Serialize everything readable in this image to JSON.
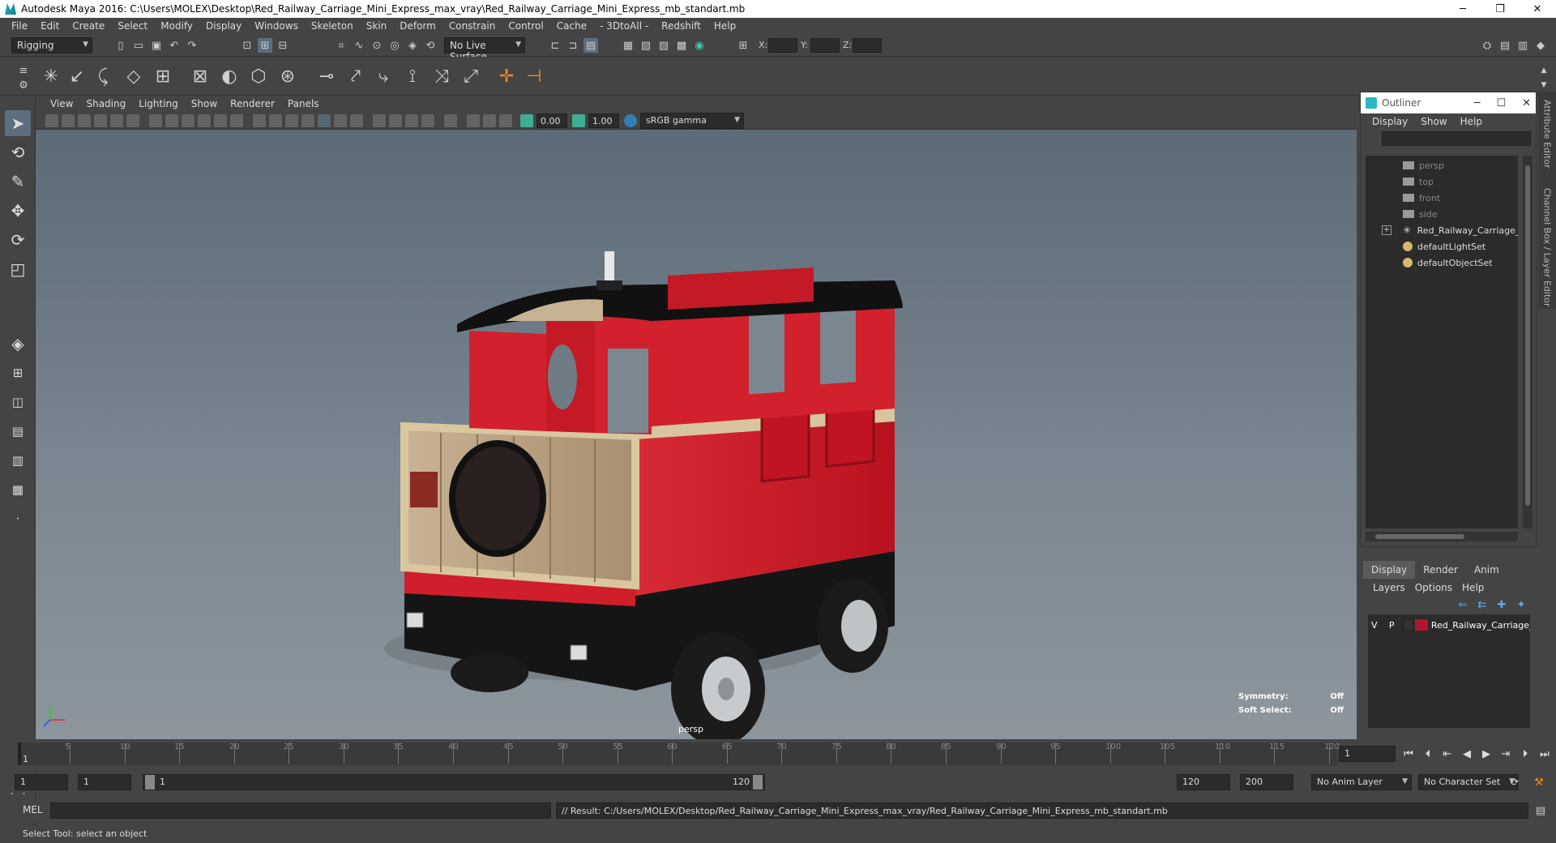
{
  "window": {
    "title": "Autodesk Maya 2016: C:\\Users\\MOLEX\\Desktop\\Red_Railway_Carriage_Mini_Express_max_vray\\Red_Railway_Carriage_Mini_Express_mb_standart.mb",
    "controls": [
      "minimize-icon",
      "restore-icon",
      "close-icon"
    ]
  },
  "menubar": [
    "File",
    "Edit",
    "Create",
    "Select",
    "Modify",
    "Display",
    "Windows",
    "Skeleton",
    "Skin",
    "Deform",
    "Constrain",
    "Control",
    "Cache",
    "- 3DtoAll -",
    "Redshift",
    "Help"
  ],
  "statusline": {
    "menuset": "Rigging",
    "live_surface": "No Live Surface",
    "x_label": "X:",
    "y_label": "Y:",
    "z_label": "Z:"
  },
  "viewport": {
    "menu": [
      "View",
      "Shading",
      "Lighting",
      "Show",
      "Renderer",
      "Panels"
    ],
    "exposure": "0.00",
    "gamma": "1.00",
    "colorspace": "sRGB gamma",
    "camera_label": "persp",
    "symmetry_label": "Symmetry:",
    "symmetry_value": "Off",
    "softselect_label": "Soft Select:",
    "softselect_value": "Off"
  },
  "outliner": {
    "title": "Outliner",
    "menu": [
      "Display",
      "Show",
      "Help"
    ],
    "items": [
      {
        "label": "persp",
        "type": "camera"
      },
      {
        "label": "top",
        "type": "camera"
      },
      {
        "label": "front",
        "type": "camera"
      },
      {
        "label": "side",
        "type": "camera"
      },
      {
        "label": "Red_Railway_Carriage_Mini",
        "type": "group"
      },
      {
        "label": "defaultLightSet",
        "type": "set"
      },
      {
        "label": "defaultObjectSet",
        "type": "set"
      }
    ]
  },
  "side_tabs": [
    "Attribute Editor",
    "Channel Box / Layer Editor"
  ],
  "layer_editor": {
    "tabs": [
      "Display",
      "Render",
      "Anim"
    ],
    "menu": [
      "Layers",
      "Options",
      "Help"
    ],
    "layer": {
      "v": "V",
      "p": "P",
      "name": "Red_Railway_Carriage_",
      "color": "#b01530"
    }
  },
  "timeline": {
    "ticks": [
      "5",
      "10",
      "15",
      "20",
      "25",
      "30",
      "35",
      "40",
      "45",
      "50",
      "55",
      "60",
      "65",
      "70",
      "75",
      "80",
      "85",
      "90",
      "95",
      "100",
      "105",
      "110",
      "115",
      "120"
    ],
    "current": "1",
    "current_frame_field": "1"
  },
  "range": {
    "start": "1",
    "playback_start": "1",
    "bar_start": "1",
    "bar_end": "120",
    "playback_end": "120",
    "end": "200",
    "anim_layer": "No Anim Layer",
    "character_set": "No Character Set"
  },
  "cmdline": {
    "label": "MEL",
    "result": "// Result: C:/Users/MOLEX/Desktop/Red_Railway_Carriage_Mini_Express_max_vray/Red_Railway_Carriage_Mini_Express_mb_standart.mb"
  },
  "helpline": "Select Tool: select an object"
}
